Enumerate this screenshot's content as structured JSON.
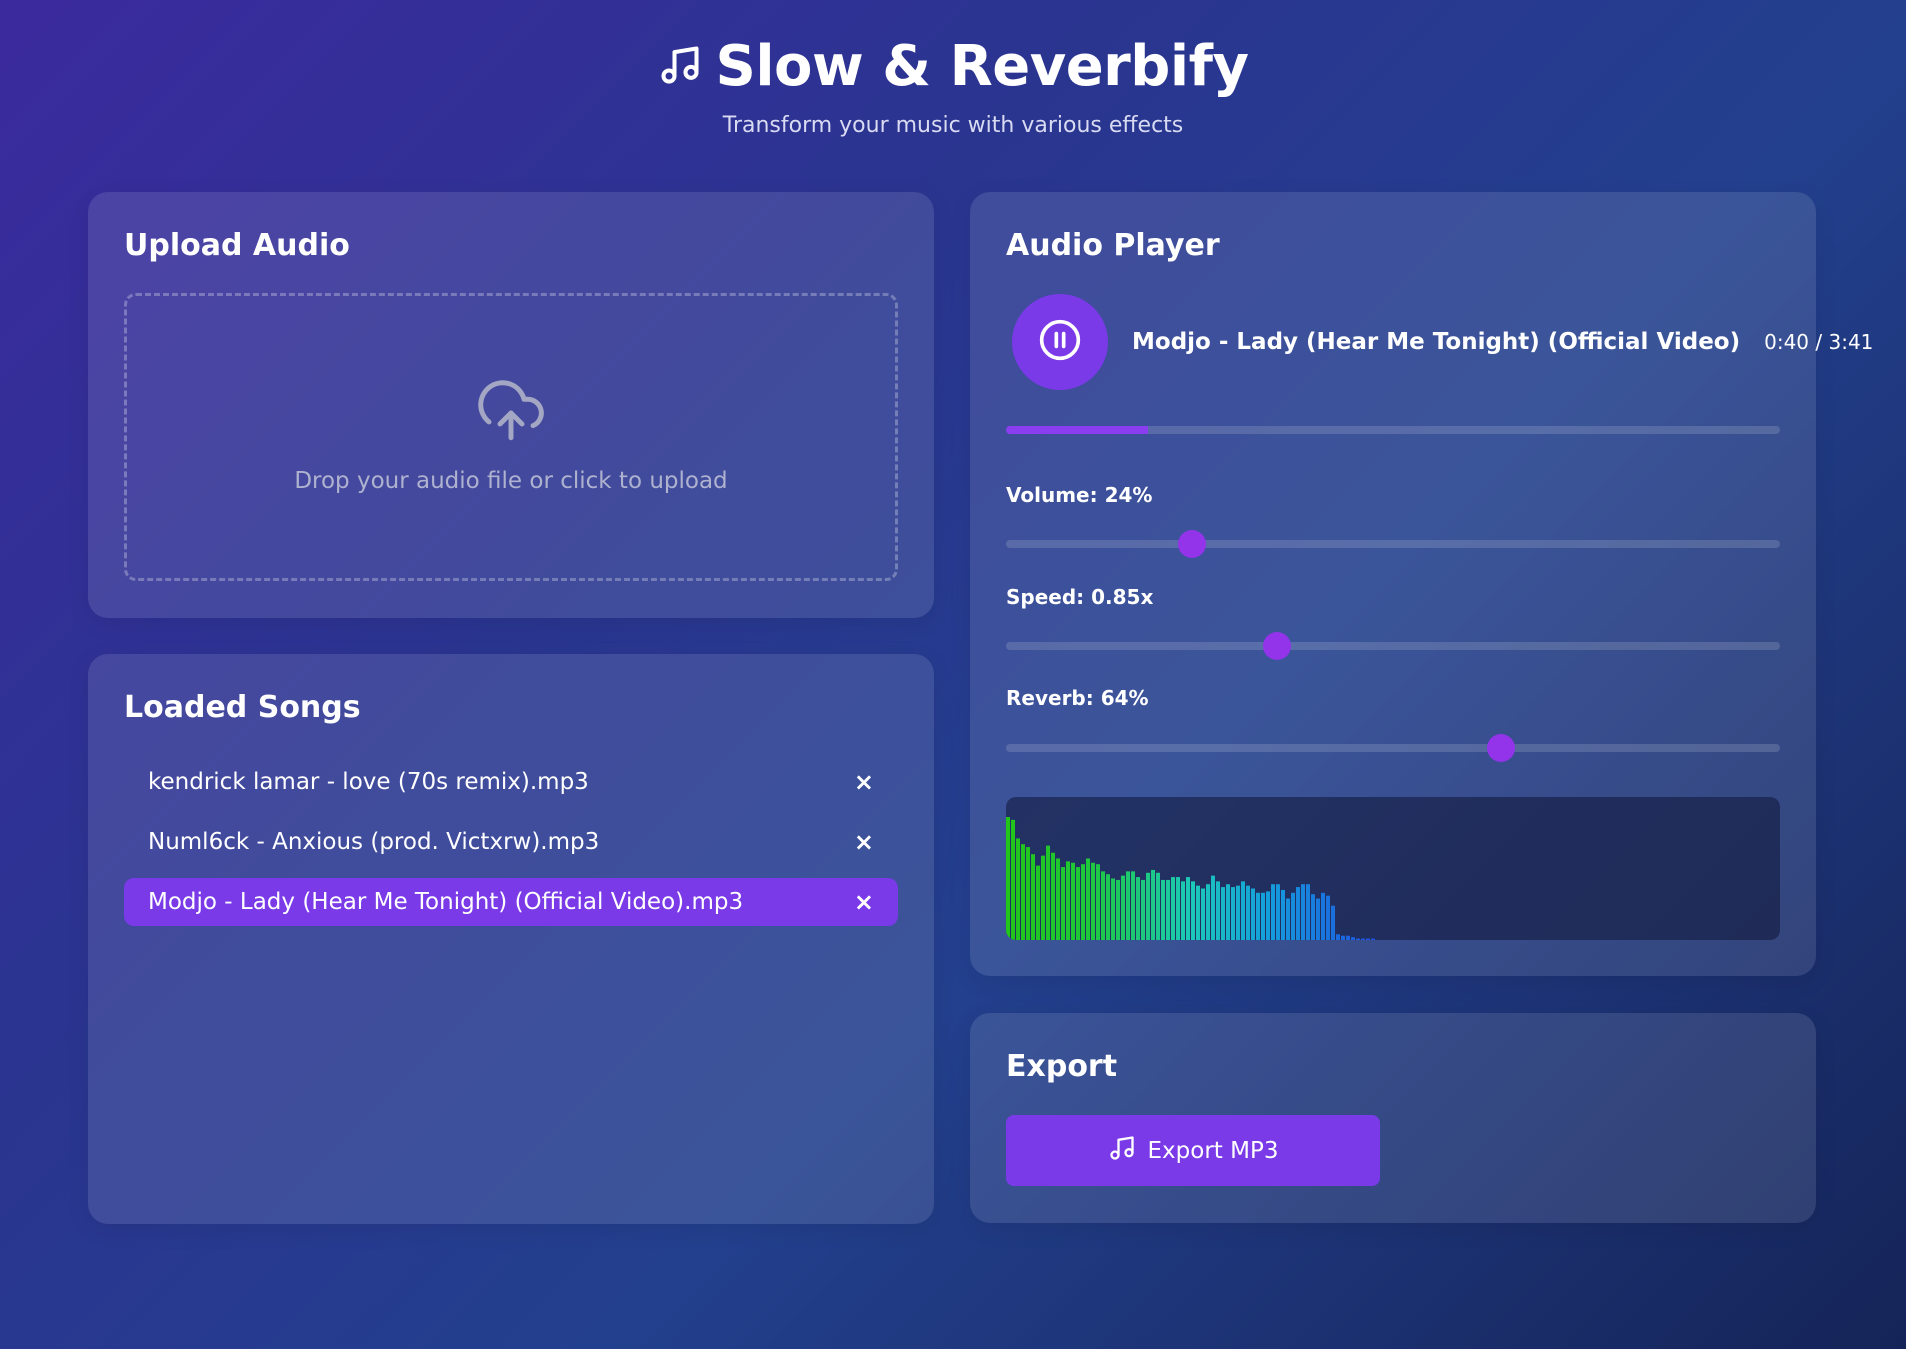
{
  "header": {
    "title": "Slow & Reverbify",
    "subtitle": "Transform your music with various effects"
  },
  "upload": {
    "heading": "Upload Audio",
    "drop_text": "Drop your audio file or click to upload"
  },
  "songs": {
    "heading": "Loaded Songs",
    "remove_symbol": "×",
    "items": [
      {
        "name": "kendrick lamar - love (70s remix).mp3",
        "active": false
      },
      {
        "name": "Numl6ck - Anxious (prod. Victxrw).mp3",
        "active": false
      },
      {
        "name": "Modjo - Lady (Hear Me Tonight) (Official Video).mp3",
        "active": true
      }
    ]
  },
  "player": {
    "heading": "Audio Player",
    "track_title": "Modjo - Lady (Hear Me Tonight) (Official Video)",
    "time_display": "0:40 / 3:41",
    "progress_fraction": 0.183,
    "volume_label": "Volume: 24%",
    "volume_value": 0.24,
    "speed_label": "Speed: 0.85x",
    "speed_fraction": 0.35,
    "reverb_label": "Reverb: 64%",
    "reverb_value": 0.64,
    "visualizer_levels": [
      0.86,
      0.84,
      0.71,
      0.67,
      0.65,
      0.6,
      0.52,
      0.59,
      0.66,
      0.61,
      0.57,
      0.51,
      0.55,
      0.54,
      0.51,
      0.53,
      0.57,
      0.54,
      0.53,
      0.48,
      0.46,
      0.43,
      0.42,
      0.45,
      0.48,
      0.48,
      0.44,
      0.42,
      0.47,
      0.49,
      0.47,
      0.42,
      0.42,
      0.44,
      0.44,
      0.41,
      0.44,
      0.41,
      0.38,
      0.36,
      0.39,
      0.45,
      0.41,
      0.37,
      0.39,
      0.37,
      0.38,
      0.41,
      0.38,
      0.36,
      0.33,
      0.33,
      0.34,
      0.39,
      0.39,
      0.35,
      0.29,
      0.33,
      0.37,
      0.39,
      0.39,
      0.32,
      0.29,
      0.33,
      0.31,
      0.24,
      0.04,
      0.03,
      0.03,
      0.02,
      0.01,
      0.01,
      0.01,
      0.01
    ],
    "colors": {
      "accent": "#7a3ae8",
      "thumb": "#9333ea"
    }
  },
  "export": {
    "heading": "Export",
    "button_label": "Export MP3"
  }
}
